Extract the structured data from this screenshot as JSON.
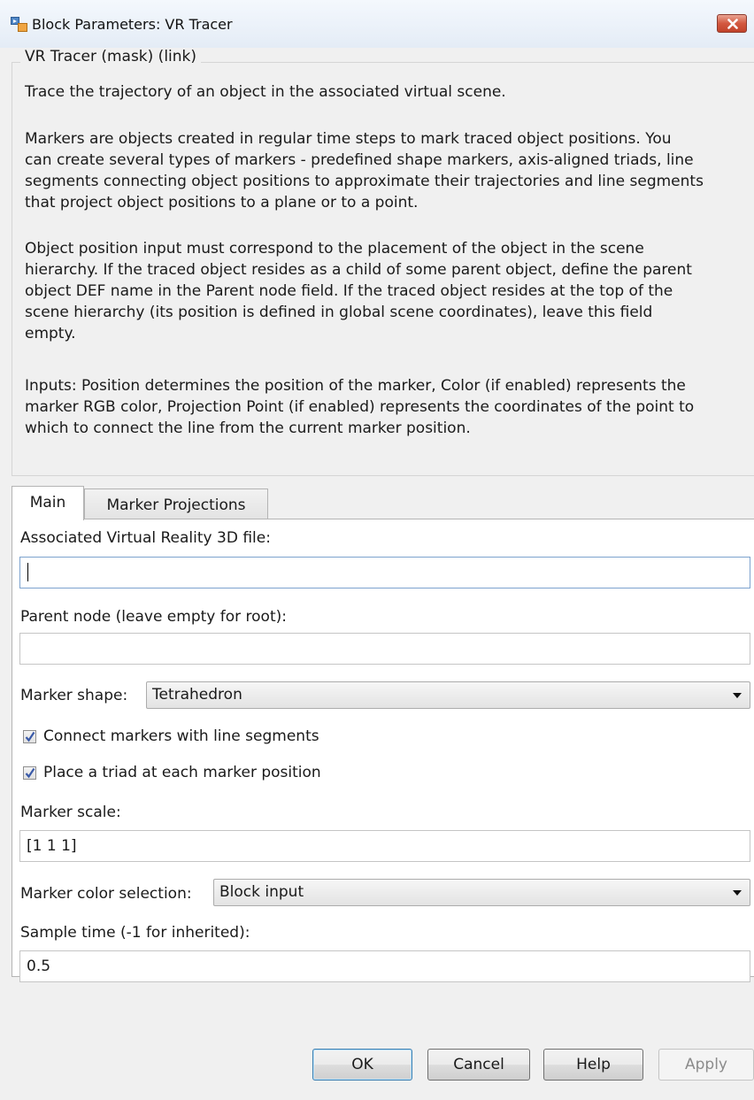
{
  "window": {
    "title": "Block Parameters: VR Tracer",
    "icon": "simulink-block-icon",
    "close_icon": "close-icon"
  },
  "description": {
    "group_title": "VR Tracer (mask) (link)",
    "paragraphs": [
      [
        "Trace the trajectory of an object in the associated virtual scene."
      ],
      [
        "Markers are objects created in regular time steps to mark traced object positions. You",
        "can create several types of markers - predefined shape markers, axis-aligned triads, line",
        "segments connecting object positions to approximate their trajectories and line segments",
        "that project object positions to a plane or to a point."
      ],
      [
        "Object position input must correspond to the placement of the object in the scene",
        "hierarchy. If the traced object resides as a child of some parent object, define the parent",
        "object DEF name in the Parent node field. If the traced object resides at the top of the",
        "scene hierarchy (its position is defined in global scene coordinates), leave this field",
        "empty."
      ],
      [
        "Inputs: Position determines the position of the marker, Color (if enabled) represents the",
        "marker RGB color, Projection Point (if enabled) represents the coordinates of the point to",
        "which to connect the line from the current marker position."
      ]
    ]
  },
  "tabs": [
    {
      "label": "Main",
      "active": true
    },
    {
      "label": "Marker Projections",
      "active": false
    }
  ],
  "main": {
    "vr_file": {
      "label": "Associated Virtual Reality 3D file:",
      "value": ""
    },
    "parent_node": {
      "label": "Parent node (leave empty for root):",
      "value": ""
    },
    "marker_shape": {
      "label": "Marker shape:",
      "value": "Tetrahedron"
    },
    "connect_markers": {
      "label": "Connect markers with line segments",
      "checked": true
    },
    "place_triad": {
      "label": "Place a triad at each marker position",
      "checked": true
    },
    "marker_scale": {
      "label": "Marker scale:",
      "value": "[1 1 1]"
    },
    "marker_color": {
      "label": "Marker color selection:",
      "value": "Block input"
    },
    "sample_time": {
      "label": "Sample time (-1 for inherited):",
      "value": "0.5"
    }
  },
  "buttons": {
    "ok": "OK",
    "cancel": "Cancel",
    "help": "Help",
    "apply": "Apply"
  },
  "colors": {
    "close_button": "#c1432b",
    "focus_border": "#7da2ce",
    "default_button_border": "#3c7fb1"
  }
}
